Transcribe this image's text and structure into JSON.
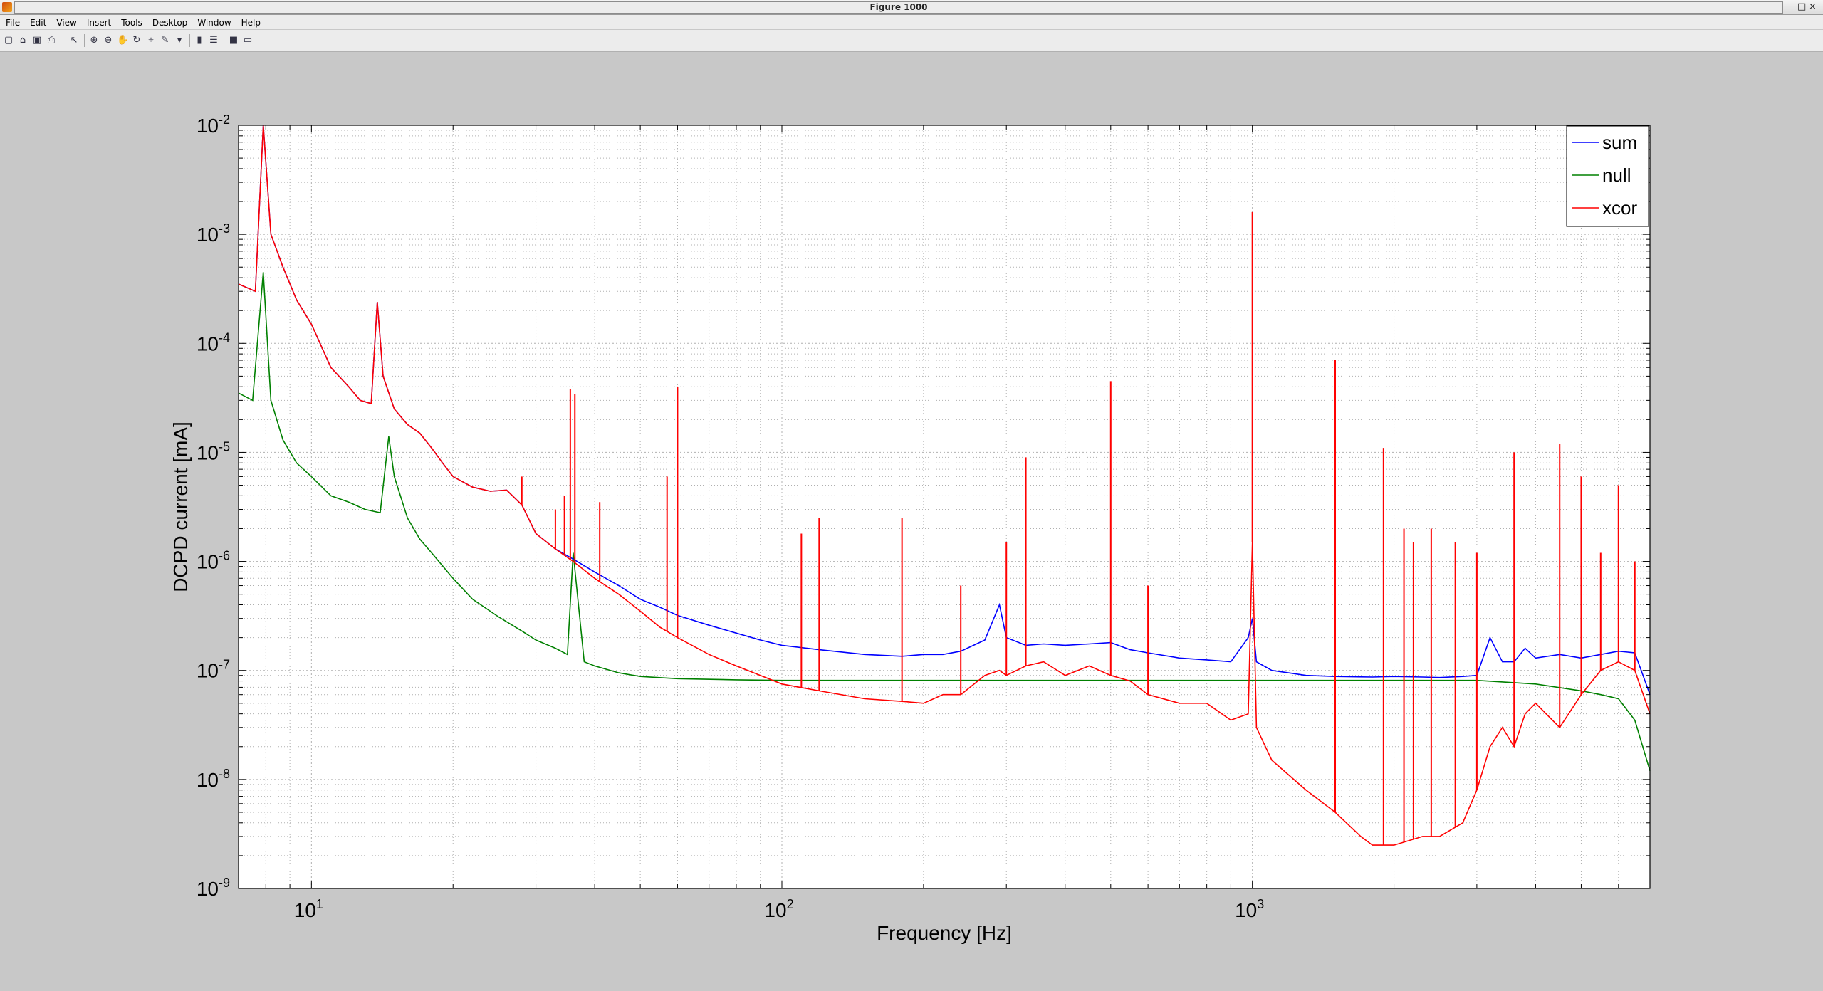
{
  "window": {
    "title": "Figure 1000"
  },
  "menu": [
    "File",
    "Edit",
    "View",
    "Insert",
    "Tools",
    "Desktop",
    "Window",
    "Help"
  ],
  "toolbar_icons": [
    "new-figure-icon",
    "open-file-icon",
    "save-icon",
    "print-icon",
    "select-arrow-icon",
    "zoom-in-icon",
    "zoom-out-icon",
    "pan-icon",
    "rotate-3d-icon",
    "data-cursor-icon",
    "brush-icon",
    "link-plot-icon",
    "insert-colorbar-icon",
    "insert-legend-icon",
    "hide-plot-tools-icon",
    "show-plot-tools-icon"
  ],
  "chart_data": {
    "type": "line",
    "xlabel": "Frequency [Hz]",
    "ylabel": "DCPD current [mA]",
    "xscale": "log",
    "yscale": "log",
    "xlim": [
      7,
      7000
    ],
    "ylim": [
      1e-09,
      0.01
    ],
    "xticks": [
      10,
      100,
      1000
    ],
    "xtick_labels": [
      {
        "base": "10",
        "exp": "1"
      },
      {
        "base": "10",
        "exp": "2"
      },
      {
        "base": "10",
        "exp": "3"
      }
    ],
    "yticks": [
      1e-09,
      1e-08,
      1e-07,
      1e-06,
      1e-05,
      0.0001,
      0.001,
      0.01
    ],
    "ytick_labels": [
      {
        "base": "10",
        "exp": "-9"
      },
      {
        "base": "10",
        "exp": "-8"
      },
      {
        "base": "10",
        "exp": "-7"
      },
      {
        "base": "10",
        "exp": "-6"
      },
      {
        "base": "10",
        "exp": "-5"
      },
      {
        "base": "10",
        "exp": "-4"
      },
      {
        "base": "10",
        "exp": "-3"
      },
      {
        "base": "10",
        "exp": "-2"
      }
    ],
    "grid": true,
    "minor_grid": true,
    "legend_position": "top-right",
    "series": [
      {
        "name": "sum",
        "color": "#0000ff",
        "x": [
          7,
          7.6,
          7.9,
          8.2,
          8.7,
          9.3,
          10,
          11,
          12,
          12.7,
          13.4,
          13.8,
          14.2,
          15,
          16,
          17,
          18,
          19,
          20,
          22,
          24,
          26,
          28,
          30,
          33,
          36,
          40,
          45,
          50,
          55,
          60,
          70,
          80,
          90,
          100,
          120,
          150,
          180,
          200,
          220,
          240,
          270,
          290,
          300,
          330,
          360,
          400,
          450,
          500,
          550,
          600,
          700,
          800,
          900,
          980,
          1000,
          1020,
          1100,
          1300,
          1500,
          1800,
          2000,
          2300,
          2500,
          2800,
          3000,
          3200,
          3400,
          3600,
          3800,
          4000,
          4500,
          5000,
          5500,
          6000,
          6500,
          7000
        ],
        "y": [
          0.00035,
          0.0003,
          0.01,
          0.001,
          0.0005,
          0.00025,
          0.00015,
          6e-05,
          4e-05,
          3e-05,
          2.8e-05,
          0.00024,
          5e-05,
          2.5e-05,
          1.8e-05,
          1.5e-05,
          1.1e-05,
          8e-06,
          6e-06,
          4.8e-06,
          4.4e-06,
          4.5e-06,
          3.3e-06,
          1.8e-06,
          1.3e-06,
          1.05e-06,
          8e-07,
          6e-07,
          4.5e-07,
          3.8e-07,
          3.2e-07,
          2.6e-07,
          2.2e-07,
          1.9e-07,
          1.7e-07,
          1.55e-07,
          1.4e-07,
          1.35e-07,
          1.4e-07,
          1.4e-07,
          1.5e-07,
          1.9e-07,
          4e-07,
          2e-07,
          1.7e-07,
          1.75e-07,
          1.7e-07,
          1.75e-07,
          1.8e-07,
          1.55e-07,
          1.45e-07,
          1.3e-07,
          1.25e-07,
          1.2e-07,
          2e-07,
          3e-07,
          1.2e-07,
          1e-07,
          9e-08,
          8.8e-08,
          8.7e-08,
          8.8e-08,
          8.7e-08,
          8.6e-08,
          8.8e-08,
          9e-08,
          2e-07,
          1.2e-07,
          1.2e-07,
          1.6e-07,
          1.3e-07,
          1.4e-07,
          1.3e-07,
          1.4e-07,
          1.5e-07,
          1.45e-07,
          6e-08
        ]
      },
      {
        "name": "null",
        "color": "#008000",
        "x": [
          7,
          7.5,
          7.9,
          8.2,
          8.7,
          9.3,
          10,
          11,
          12,
          13,
          14,
          14.6,
          15,
          16,
          17,
          18,
          20,
          22,
          25,
          28,
          30,
          33,
          35,
          36,
          38,
          40,
          45,
          50,
          60,
          80,
          100,
          150,
          200,
          300,
          500,
          700,
          1000,
          1500,
          2000,
          3000,
          4000,
          5000,
          5500,
          6000,
          6500,
          7000
        ],
        "y": [
          3.5e-05,
          3e-05,
          0.00045,
          3e-05,
          1.3e-05,
          8e-06,
          6e-06,
          4e-06,
          3.5e-06,
          3e-06,
          2.8e-06,
          1.4e-05,
          6e-06,
          2.5e-06,
          1.6e-06,
          1.2e-06,
          7e-07,
          4.5e-07,
          3.1e-07,
          2.3e-07,
          1.9e-07,
          1.6e-07,
          1.4e-07,
          1.2e-06,
          1.2e-07,
          1.1e-07,
          9.5e-08,
          8.8e-08,
          8.4e-08,
          8.2e-08,
          8.1e-08,
          8.1e-08,
          8.1e-08,
          8.1e-08,
          8.1e-08,
          8.1e-08,
          8.1e-08,
          8.1e-08,
          8.1e-08,
          8.1e-08,
          7.5e-08,
          6.5e-08,
          6e-08,
          5.5e-08,
          3.5e-08,
          1.2e-08
        ]
      },
      {
        "name": "xcor",
        "color": "#ff0000",
        "x": [
          7,
          7.6,
          7.9,
          8.2,
          8.7,
          9.3,
          10,
          11,
          12,
          12.7,
          13.4,
          13.8,
          14.2,
          15,
          16,
          17,
          18,
          19,
          20,
          22,
          24,
          26,
          28,
          30,
          33,
          36,
          40,
          45,
          50,
          55,
          60,
          70,
          80,
          90,
          100,
          120,
          150,
          180,
          200,
          220,
          240,
          270,
          290,
          300,
          330,
          360,
          400,
          450,
          500,
          550,
          600,
          700,
          800,
          900,
          980,
          1000,
          1020,
          1100,
          1300,
          1500,
          1700,
          1800,
          2000,
          2300,
          2500,
          2800,
          3000,
          3200,
          3400,
          3600,
          3800,
          4000,
          4500,
          5000,
          5500,
          6000,
          6500,
          7000
        ],
        "y": [
          0.00035,
          0.0003,
          0.01,
          0.001,
          0.0005,
          0.00025,
          0.00015,
          6e-05,
          4e-05,
          3e-05,
          2.8e-05,
          0.00024,
          5e-05,
          2.5e-05,
          1.8e-05,
          1.5e-05,
          1.1e-05,
          8e-06,
          6e-06,
          4.8e-06,
          4.4e-06,
          4.5e-06,
          3.3e-06,
          1.8e-06,
          1.3e-06,
          1e-06,
          7e-07,
          5e-07,
          3.5e-07,
          2.5e-07,
          2e-07,
          1.4e-07,
          1.1e-07,
          9e-08,
          7.5e-08,
          6.5e-08,
          5.5e-08,
          5.2e-08,
          5e-08,
          6e-08,
          6e-08,
          9e-08,
          1e-07,
          9e-08,
          1.1e-07,
          1.2e-07,
          9e-08,
          1.1e-07,
          9e-08,
          8e-08,
          6e-08,
          5e-08,
          5e-08,
          3.5e-08,
          4e-08,
          1.5e-06,
          3e-08,
          1.5e-08,
          8e-09,
          5e-09,
          3e-09,
          2.5e-09,
          2.5e-09,
          3e-09,
          3e-09,
          4e-09,
          8e-09,
          2e-08,
          3e-08,
          2e-08,
          4e-08,
          5e-08,
          3e-08,
          6e-08,
          1e-07,
          1.2e-07,
          1e-07,
          4e-08
        ]
      }
    ],
    "peaks": [
      {
        "x": 35.5,
        "y": 3.8e-05
      },
      {
        "x": 36.3,
        "y": 3.4e-05
      },
      {
        "x": 34.5,
        "y": 4e-06
      },
      {
        "x": 33,
        "y": 3e-06
      },
      {
        "x": 28,
        "y": 6e-06
      },
      {
        "x": 41,
        "y": 3.5e-06
      },
      {
        "x": 57,
        "y": 6e-06
      },
      {
        "x": 60,
        "y": 4e-05
      },
      {
        "x": 110,
        "y": 1.8e-06
      },
      {
        "x": 120,
        "y": 2.5e-06
      },
      {
        "x": 180,
        "y": 2.5e-06
      },
      {
        "x": 240,
        "y": 6e-07
      },
      {
        "x": 300,
        "y": 1.5e-06
      },
      {
        "x": 330,
        "y": 9e-06
      },
      {
        "x": 500,
        "y": 4.5e-05
      },
      {
        "x": 600,
        "y": 6e-07
      },
      {
        "x": 1000,
        "y": 0.0016
      },
      {
        "x": 1500,
        "y": 7e-05
      },
      {
        "x": 1900,
        "y": 1.1e-05
      },
      {
        "x": 2100,
        "y": 2e-06
      },
      {
        "x": 2200,
        "y": 1.5e-06
      },
      {
        "x": 2400,
        "y": 2e-06
      },
      {
        "x": 2700,
        "y": 1.5e-06
      },
      {
        "x": 3000,
        "y": 1.2e-06
      },
      {
        "x": 3600,
        "y": 1e-05
      },
      {
        "x": 4500,
        "y": 1.2e-05
      },
      {
        "x": 5000,
        "y": 6e-06
      },
      {
        "x": 5500,
        "y": 1.2e-06
      },
      {
        "x": 6000,
        "y": 5e-06
      },
      {
        "x": 6500,
        "y": 1e-06
      }
    ]
  }
}
